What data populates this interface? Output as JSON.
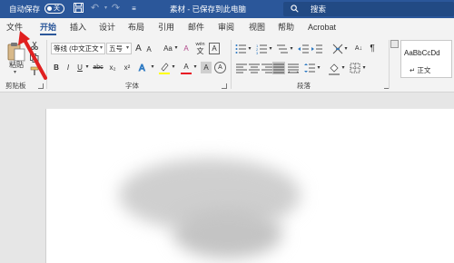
{
  "titlebar": {
    "autosave_label": "自动保存",
    "autosave_state": "关",
    "doc_title": "素材 - 已保存到此电脑",
    "search_placeholder": "搜索"
  },
  "tabs": [
    "文件",
    "开始",
    "插入",
    "设计",
    "布局",
    "引用",
    "邮件",
    "审阅",
    "视图",
    "帮助",
    "Acrobat"
  ],
  "active_tab": "开始",
  "ribbon": {
    "clipboard": {
      "paste_label": "粘贴",
      "group_label": "剪贴板"
    },
    "font": {
      "font_name": "等线 (中文正文",
      "font_size": "五号",
      "grow": "A",
      "shrink": "A",
      "case": "Aa",
      "clear_format": "A",
      "wen": "wén",
      "wen_char": "文",
      "char_border": "A",
      "bold": "B",
      "italic": "I",
      "underline": "U",
      "strike": "abc",
      "subscript": "x₂",
      "superscript": "x²",
      "font_color": "A",
      "shade": "A",
      "enclose": "A",
      "group_label": "字体"
    },
    "paragraph": {
      "group_label": "段落",
      "sort_label": "A↓"
    },
    "styles": {
      "sample": "AaBbCcDd",
      "style_name": "↵ 正文"
    }
  },
  "colors": {
    "title_blue": "#2b579a",
    "highlight_yellow": "#ffff00",
    "font_red": "#e81123",
    "arrow_red": "#e02020"
  }
}
